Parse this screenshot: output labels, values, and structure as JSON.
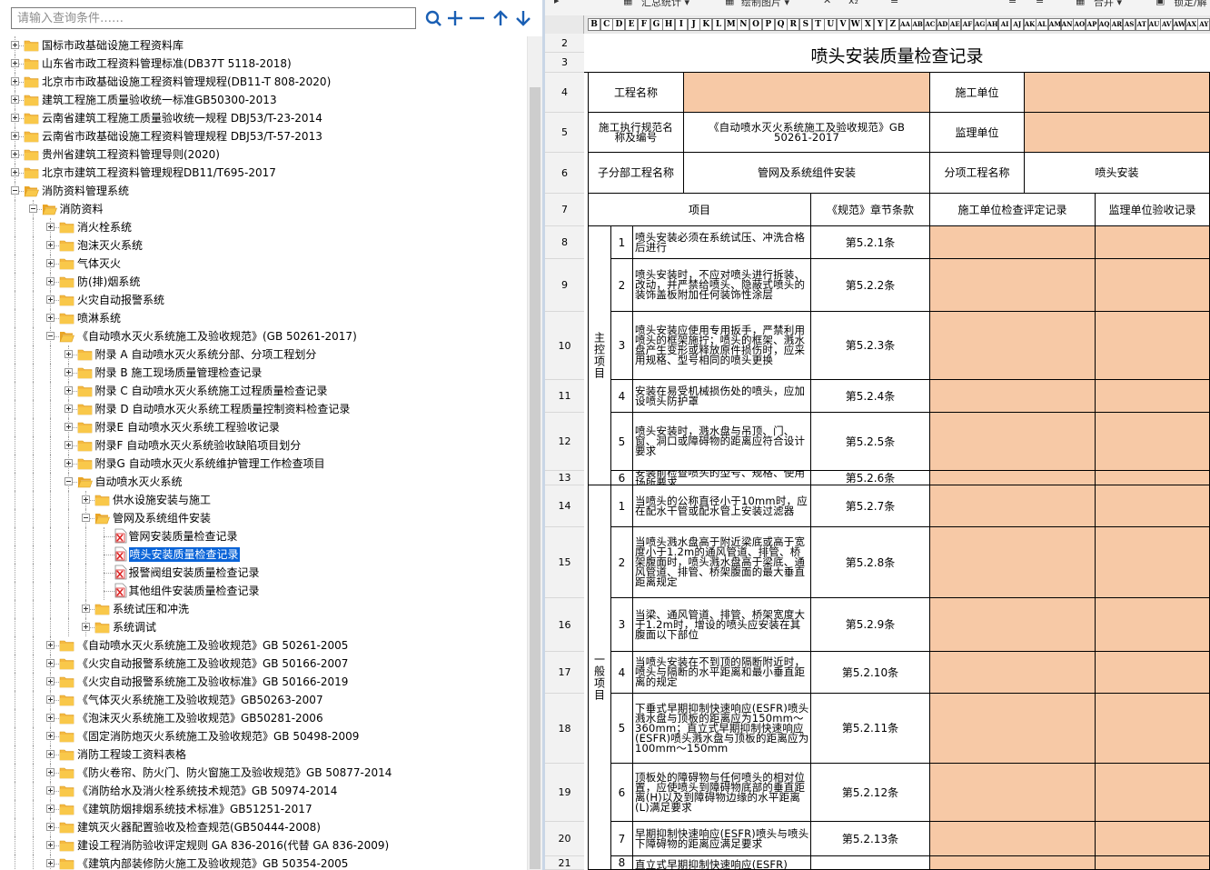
{
  "search": {
    "placeholder": "请输入查询条件……"
  },
  "toolbar_left": {
    "icons": [
      "search-icon",
      "add-icon",
      "minus-icon",
      "arrow-up-icon",
      "arrow-down-icon"
    ]
  },
  "tree": [
    {
      "depth": 0,
      "kind": "folder",
      "exp": "plus",
      "label": "国标市政基础设施工程资料库"
    },
    {
      "depth": 0,
      "kind": "folder",
      "exp": "plus",
      "label": "山东省市政工程资料管理标准(DB37T 5118-2018)"
    },
    {
      "depth": 0,
      "kind": "folder",
      "exp": "plus",
      "label": "北京市市政基础设施工程资料管理规程(DB11-T 808-2020)"
    },
    {
      "depth": 0,
      "kind": "folder",
      "exp": "plus",
      "label": "建筑工程施工质量验收统一标准GB50300-2013"
    },
    {
      "depth": 0,
      "kind": "folder",
      "exp": "plus",
      "label": "云南省建筑工程施工质量验收统一规程 DBJ53/T-23-2014"
    },
    {
      "depth": 0,
      "kind": "folder",
      "exp": "plus",
      "label": "云南省市政基础设施工程资料管理规程 DBJ53/T-57-2013"
    },
    {
      "depth": 0,
      "kind": "folder",
      "exp": "plus",
      "label": "贵州省建筑工程资料管理导则(2020)"
    },
    {
      "depth": 0,
      "kind": "folder",
      "exp": "plus",
      "label": "北京市建筑工程资料管理规程DB11/T695-2017"
    },
    {
      "depth": 0,
      "kind": "folder",
      "exp": "minus",
      "label": "消防资料管理系统"
    },
    {
      "depth": 1,
      "kind": "folder",
      "exp": "minus",
      "label": "消防资料"
    },
    {
      "depth": 2,
      "kind": "folder",
      "exp": "plus",
      "label": "消火栓系统"
    },
    {
      "depth": 2,
      "kind": "folder",
      "exp": "plus",
      "label": "泡沫灭火系统"
    },
    {
      "depth": 2,
      "kind": "folder",
      "exp": "plus",
      "label": "气体灭火"
    },
    {
      "depth": 2,
      "kind": "folder",
      "exp": "plus",
      "label": "防(排)烟系统"
    },
    {
      "depth": 2,
      "kind": "folder",
      "exp": "plus",
      "label": "火灾自动报警系统"
    },
    {
      "depth": 2,
      "kind": "folder",
      "exp": "plus",
      "label": "喷淋系统"
    },
    {
      "depth": 2,
      "kind": "folder",
      "exp": "minus",
      "label": "《自动喷水灭火系统施工及验收规范》(GB 50261-2017)"
    },
    {
      "depth": 3,
      "kind": "folder",
      "exp": "plus",
      "label": "附录 A 自动喷水灭火系统分部、分项工程划分"
    },
    {
      "depth": 3,
      "kind": "folder",
      "exp": "plus",
      "label": "附录 B 施工现场质量管理检查记录"
    },
    {
      "depth": 3,
      "kind": "folder",
      "exp": "plus",
      "label": "附录 C 自动喷水灭火系统施工过程质量检查记录"
    },
    {
      "depth": 3,
      "kind": "folder",
      "exp": "plus",
      "label": "附录 D 自动喷水灭火系统工程质量控制资料检查记录"
    },
    {
      "depth": 3,
      "kind": "folder",
      "exp": "plus",
      "label": "附录E 自动喷水灭火系统工程验收记录"
    },
    {
      "depth": 3,
      "kind": "folder",
      "exp": "plus",
      "label": "附录F 自动喷水灭火系统验收缺陷项目划分"
    },
    {
      "depth": 3,
      "kind": "folder",
      "exp": "plus",
      "label": "附录G 自动喷水灭火系统维护管理工作检查项目"
    },
    {
      "depth": 3,
      "kind": "folder",
      "exp": "minus",
      "label": "自动喷水灭火系统"
    },
    {
      "depth": 4,
      "kind": "folder",
      "exp": "plus",
      "label": "供水设施安装与施工"
    },
    {
      "depth": 4,
      "kind": "folder",
      "exp": "minus",
      "label": "管网及系统组件安装"
    },
    {
      "depth": 5,
      "kind": "file",
      "exp": "",
      "label": "管网安装质量检查记录"
    },
    {
      "depth": 5,
      "kind": "file",
      "exp": "",
      "label": "喷头安装质量检查记录",
      "selected": true
    },
    {
      "depth": 5,
      "kind": "file",
      "exp": "",
      "label": "报警阀组安装质量检查记录"
    },
    {
      "depth": 5,
      "kind": "file",
      "exp": "",
      "label": "其他组件安装质量检查记录"
    },
    {
      "depth": 4,
      "kind": "folder",
      "exp": "plus",
      "label": "系统试压和冲洗"
    },
    {
      "depth": 4,
      "kind": "folder",
      "exp": "plus",
      "label": "系统调试"
    },
    {
      "depth": 2,
      "kind": "folder",
      "exp": "plus",
      "label": "《自动喷水灭火系统施工及验收规范》GB 50261-2005"
    },
    {
      "depth": 2,
      "kind": "folder",
      "exp": "plus",
      "label": "《火灾自动报警系统施工及验收规范》GB 50166-2007"
    },
    {
      "depth": 2,
      "kind": "folder",
      "exp": "plus",
      "label": "《火灾自动报警系统施工及验收标准》GB 50166-2019"
    },
    {
      "depth": 2,
      "kind": "folder",
      "exp": "plus",
      "label": "《气体灭火系统施工及验收规范》GB50263-2007"
    },
    {
      "depth": 2,
      "kind": "folder",
      "exp": "plus",
      "label": "《泡沫灭火系统施工及验收规范》GB50281-2006"
    },
    {
      "depth": 2,
      "kind": "folder",
      "exp": "plus",
      "label": "《固定消防炮灭火系统施工及验收规范》GB 50498-2009"
    },
    {
      "depth": 2,
      "kind": "folder",
      "exp": "plus",
      "label": "消防工程竣工资料表格"
    },
    {
      "depth": 2,
      "kind": "folder",
      "exp": "plus",
      "label": "《防火卷帘、防火门、防火窗施工及验收规范》GB 50877-2014"
    },
    {
      "depth": 2,
      "kind": "folder",
      "exp": "plus",
      "label": "《消防给水及消火栓系统技术规范》GB 50974-2014"
    },
    {
      "depth": 2,
      "kind": "folder",
      "exp": "plus",
      "label": "《建筑防烟排烟系统技术标准》GB51251-2017"
    },
    {
      "depth": 2,
      "kind": "folder",
      "exp": "plus",
      "label": "建筑灭火器配置验收及检查规范(GB50444-2008)"
    },
    {
      "depth": 2,
      "kind": "folder",
      "exp": "plus",
      "label": "建设工程消防验收评定规则 GA 836-2016(代替 GA 836-2009)"
    },
    {
      "depth": 2,
      "kind": "folder",
      "exp": "plus",
      "label": "《建筑内部装修防火施工及验收规范》GB 50354-2005"
    }
  ],
  "ribbon": {
    "items": [
      "汇总统计 ▾",
      "绘制图片 ▾",
      "合并 ▾",
      "锁定/解"
    ]
  },
  "columns": [
    "B",
    "C",
    "D",
    "E",
    "F",
    "G",
    "H",
    "I",
    "J",
    "K",
    "L",
    "M",
    "N",
    "O",
    "P",
    "Q",
    "R",
    "S",
    "T",
    "U",
    "V",
    "W",
    "X",
    "Y",
    "Z",
    "AA",
    "AB",
    "AC",
    "AD",
    "AE",
    "AF",
    "AG",
    "AH",
    "AI",
    "AJ",
    "AK",
    "AL",
    "AM",
    "AN",
    "AO",
    "AP",
    "AQ",
    "AR",
    "AS",
    "AT",
    "AU",
    "AV",
    "AW",
    "AX",
    "AY"
  ],
  "sheet": {
    "title": "喷头安装质量检查记录",
    "row_numbers": [
      "2",
      "3",
      "4",
      "5",
      "6",
      "7",
      "8",
      "9",
      "10",
      "11",
      "12",
      "13",
      "14",
      "15",
      "16",
      "17",
      "18",
      "19",
      "20",
      "21"
    ],
    "project_name_label": "工程名称",
    "construction_unit_label": "施工单位",
    "standard_label": "施工执行规范名称及编号",
    "standard_value": "《自动喷水灭火系统施工及验收规范》GB 50261-2017",
    "supervision_unit_label": "监理单位",
    "subdivision_label": "子分部工程名称",
    "subdivision_value": "管网及系统组件安装",
    "item_project_label": "分项工程名称",
    "item_project_value": "喷头安装",
    "header_item": "项目",
    "header_clause": "《规范》章节条款",
    "header_construction": "施工单位检查评定记录",
    "header_supervision": "监理单位验收记录",
    "main_control_label": "主控项目",
    "general_label": "一般项目",
    "main_items": [
      {
        "no": "1",
        "text": "喷头安装必须在系统试压、冲洗合格后进行",
        "clause": "第5.2.1条"
      },
      {
        "no": "2",
        "text": "喷头安装时，不应对喷头进行拆装、改动，并严禁给喷头、隐蔽式喷头的装饰盖板附加任何装饰性涂层",
        "clause": "第5.2.2条"
      },
      {
        "no": "3",
        "text": "喷头安装应使用专用扳手，严禁利用喷头的框架施拧；喷头的框架、溅水盘产生变形或释放原件损伤时，应采用规格、型号相同的喷头更换",
        "clause": "第5.2.3条"
      },
      {
        "no": "4",
        "text": "安装在易受机械损伤处的喷头，应加设喷头防护罩",
        "clause": "第5.2.4条"
      },
      {
        "no": "5",
        "text": "喷头安装时，溅水盘与吊顶、门、窗、洞口或障碍物的距离应符合设计要求",
        "clause": "第5.2.5条"
      },
      {
        "no": "6",
        "text": "安装前检查喷头的型号、规格、使用场所要求",
        "clause": "第5.2.6条"
      }
    ],
    "general_items": [
      {
        "no": "1",
        "text": "当喷头的公称直径小于10mm时，应在配水干管或配水管上安装过滤器",
        "clause": "第5.2.7条"
      },
      {
        "no": "2",
        "text": "当喷头溅水盘高于附近梁底或高于宽度小于1.2m的通风管道、排管、桥架腹面时，喷头溅水盘高于梁底、通风管道、排管、桥架腹面的最大垂直距离规定",
        "clause": "第5.2.8条"
      },
      {
        "no": "3",
        "text": "当梁、通风管道、排管、桥架宽度大于1.2m时，增设的喷头应安装在其腹面以下部位",
        "clause": "第5.2.9条"
      },
      {
        "no": "4",
        "text": "当喷头安装在不到顶的隔断附近时，喷头与隔断的水平距离和最小垂直距离的规定",
        "clause": "第5.2.10条"
      },
      {
        "no": "5",
        "text": "下垂式早期抑制快速响应(ESFR)喷头溅水盘与顶板的距离应为150mm～360mm；直立式早期抑制快速响应(ESFR)喷头溅水盘与顶板的距离应为100mm～150mm",
        "clause": "第5.2.11条"
      },
      {
        "no": "6",
        "text": "顶板处的障碍物与任何喷头的相对位置，应使喷头到障碍物底部的垂直距离(H)以及到障碍物边缘的水平距离(L)满足要求",
        "clause": "第5.2.12条"
      },
      {
        "no": "7",
        "text": "早期抑制快速响应(ESFR)喷头与喷头下障碍物的距离应满足要求",
        "clause": "第5.2.13条"
      },
      {
        "no": "8",
        "text": "直立式早期抑制快速响应(ESFR)",
        "clause": ""
      }
    ]
  },
  "colors": {
    "fill": "#f7c9a6",
    "selection": "#0a64d8",
    "folder": "#f5b941"
  }
}
